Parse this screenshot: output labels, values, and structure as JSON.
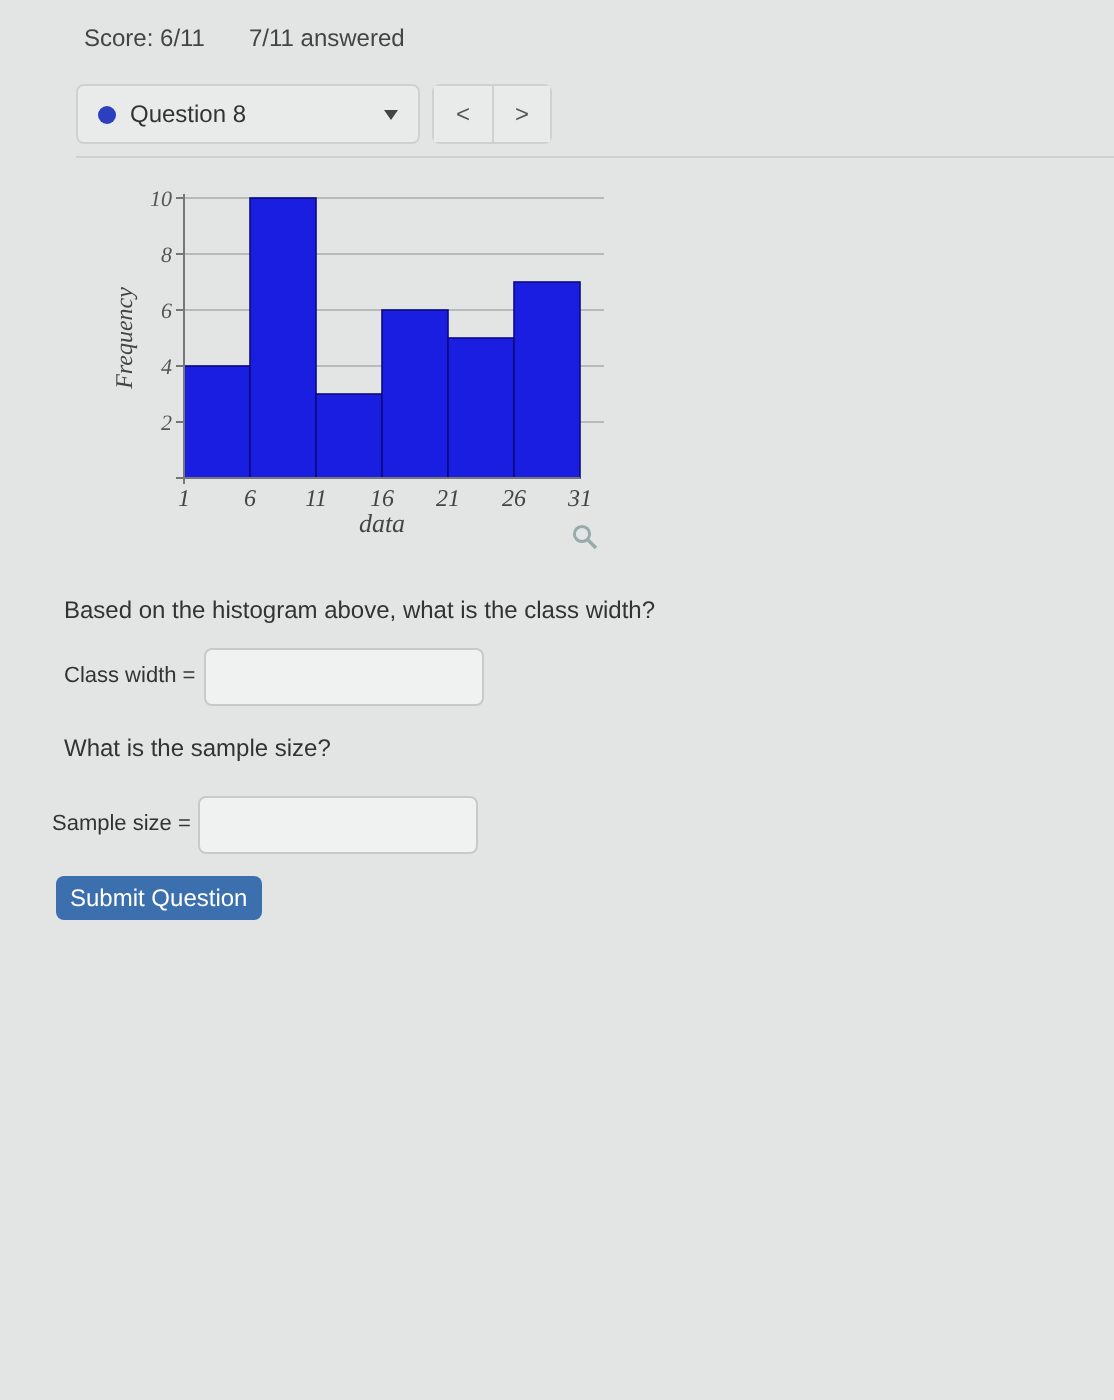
{
  "header": {
    "score": "Score: 6/11",
    "answered": "7/11 answered"
  },
  "question_selector": {
    "label": "Question 8",
    "color": "#2b3fbf"
  },
  "nav_buttons": [
    "<",
    ">"
  ],
  "chart_data": {
    "type": "bar",
    "xlabel": "data",
    "ylabel": "Frequency",
    "x": [
      3.5,
      8.5,
      13.5,
      18.5,
      23.5,
      28.5
    ],
    "values": [
      4,
      10,
      3,
      6,
      5,
      7
    ],
    "xlim": [
      1,
      31
    ],
    "ylim": [
      0,
      10
    ],
    "xticks": [
      1,
      6,
      11,
      16,
      21,
      26,
      31
    ],
    "yticks": [
      2,
      4,
      6,
      8,
      10
    ],
    "grid": true
  },
  "question_1": {
    "text": "Based on the histogram above, what is the class width?",
    "label": "Class width ="
  },
  "question_2": {
    "text": "What is the sample size?",
    "label": "Sample size ="
  },
  "submit_button": "Submit Question"
}
